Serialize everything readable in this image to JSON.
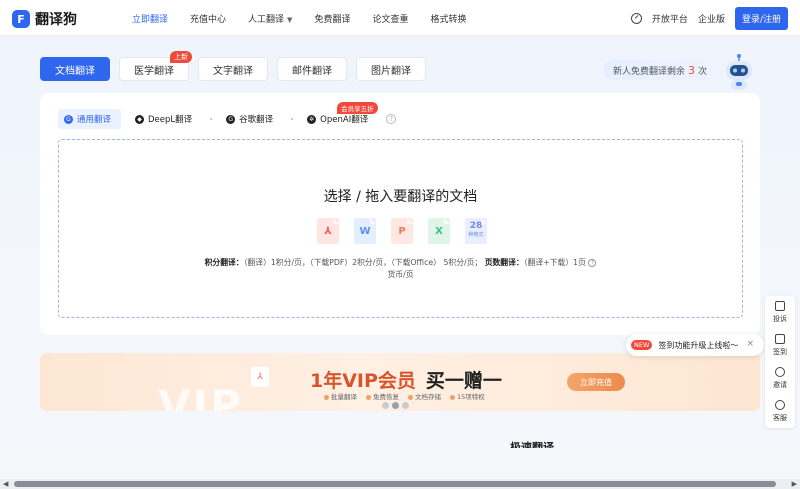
{
  "header": {
    "logo_mark": "F",
    "logo_text": "翻译狗",
    "nav": [
      {
        "label": "立即翻译",
        "active": true
      },
      {
        "label": "充值中心"
      },
      {
        "label": "人工翻译",
        "dropdown": true
      },
      {
        "label": "免费翻译"
      },
      {
        "label": "论文查重"
      },
      {
        "label": "格式转换"
      }
    ],
    "open_platform": "开放平台",
    "enterprise": "企业版",
    "login": "登录/注册"
  },
  "category_tabs": [
    {
      "label": "文档翻译",
      "active": true
    },
    {
      "label": "医学翻译",
      "badge": "上新"
    },
    {
      "label": "文字翻译"
    },
    {
      "label": "邮件翻译"
    },
    {
      "label": "图片翻译"
    }
  ],
  "free_pill": {
    "prefix": "新人免费翻译剩余",
    "count": "3",
    "suffix": "次"
  },
  "engines": [
    {
      "label": "通用翻译",
      "active": true
    },
    {
      "label": "DeepL翻译"
    },
    {
      "label": "谷歌翻译"
    },
    {
      "label": "OpenAI翻译",
      "badge": "会员享五折"
    }
  ],
  "drop_zone": {
    "title": "选择 / 拖入要翻译的文档",
    "file_types": [
      "pdf",
      "word",
      "ppt",
      "excel",
      "more"
    ],
    "more_icon": {
      "num": "28",
      "label": "种格式"
    }
  },
  "pricing": {
    "points_label": "积分翻译：",
    "points_text": "（翻译）1积分/页，（下载PDF）2积分/页，（下载Office） 5积分/页；",
    "pages_label": "页数翻译：",
    "pages_text": "（翻译+下载）1页",
    "line2": "货币/页"
  },
  "banner": {
    "bg_text": "VIP",
    "title": "1年VIP会员",
    "accent": "买一赠一",
    "features": [
      "批量翻译",
      "免费恢复",
      "文档存储",
      "15项特权"
    ],
    "button": "立即充值",
    "slides": 3,
    "active_slide": 1
  },
  "side_toolbar": [
    {
      "label": "投诉",
      "icon": "complaint-icon"
    },
    {
      "label": "签到",
      "icon": "checkin-icon"
    },
    {
      "label": "邀请",
      "icon": "invite-icon"
    },
    {
      "label": "客服",
      "icon": "headset-icon"
    }
  ],
  "toast": {
    "badge": "NEW",
    "text": "签到功能升级上线啦～",
    "close": "×"
  },
  "bottom_title": "极速翻译"
}
